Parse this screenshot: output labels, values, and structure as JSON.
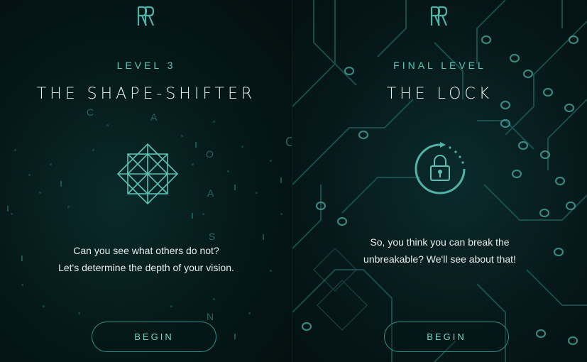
{
  "colors": {
    "accent": "#5cc7b9",
    "title": "#e6f0ee",
    "text": "#e8eeec",
    "button_border": "#2f8e86"
  },
  "panels": [
    {
      "level": "LEVEL 3",
      "title": "THE SHAPE-SHIFTER",
      "emblem_icon": "geometric-star-icon",
      "description_line1": "Can you see what others do not?",
      "description_line2": "Let's determine the depth of your vision.",
      "button_label": "BEGIN",
      "bg_letters": [
        "C",
        "A",
        "O",
        "A",
        "S",
        "N",
        "C"
      ]
    },
    {
      "level": "FINAL LEVEL",
      "title": "THE LOCK",
      "emblem_icon": "padlock-icon",
      "description_line1": "So, you think you can break the",
      "description_line2": "unbreakable? We'll see about that!",
      "button_label": "BEGIN"
    }
  ]
}
